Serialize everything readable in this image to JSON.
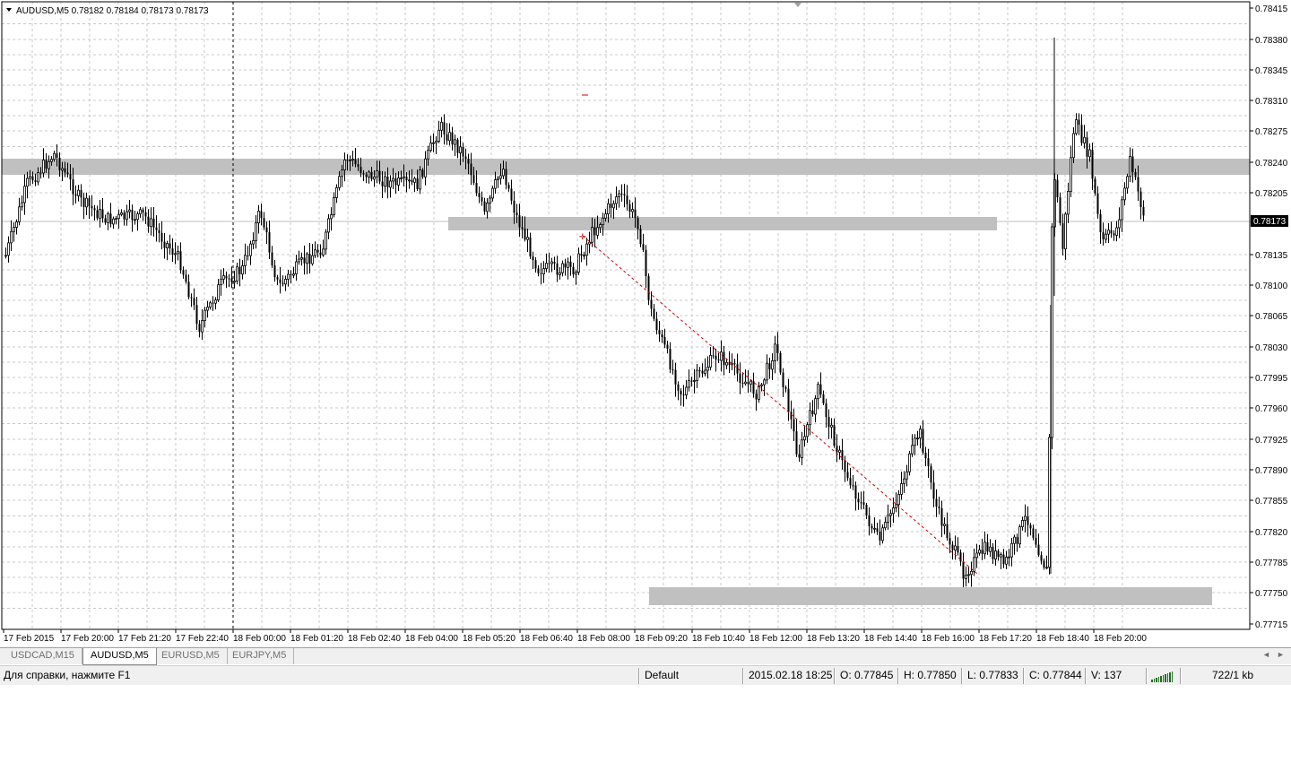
{
  "chart": {
    "header": "AUDUSD,M5  0.78182 0.78184 0.78173 0.78173",
    "current_price_label": "0.78173",
    "price_axis_labels": [
      "0.78415",
      "0.78380",
      "0.78345",
      "0.78310",
      "0.78275",
      "0.78240",
      "0.78205",
      "0.78135",
      "0.78100",
      "0.78065",
      "0.78030",
      "0.77995",
      "0.77960",
      "0.77925",
      "0.77890",
      "0.77855",
      "0.77820",
      "0.77785",
      "0.77750",
      "0.77715"
    ],
    "time_axis_labels": [
      "17 Feb 2015",
      "17 Feb 20:00",
      "17 Feb 21:20",
      "17 Feb 22:40",
      "18 Feb 00:00",
      "18 Feb 01:20",
      "18 Feb 02:40",
      "18 Feb 04:00",
      "18 Feb 05:20",
      "18 Feb 06:40",
      "18 Feb 08:00",
      "18 Feb 09:20",
      "18 Feb 10:40",
      "18 Feb 12:00",
      "18 Feb 13:20",
      "18 Feb 14:40",
      "18 Feb 16:00",
      "18 Feb 17:20",
      "18 Feb 18:40",
      "18 Feb 20:00"
    ],
    "colors": {
      "zone": "#c0c0c0",
      "grid": "#c8c8c8",
      "candle": "#000000",
      "trend_line": "#cc0000",
      "bid_line": "#bfbfbf"
    }
  },
  "tabs": [
    {
      "label": "USDCAD,M15",
      "active": false
    },
    {
      "label": "AUDUSD,M5",
      "active": true
    },
    {
      "label": "EURUSD,M5",
      "active": false
    },
    {
      "label": "EURJPY,M5",
      "active": false
    }
  ],
  "tab_scroll": {
    "left_icon": "arrow-left-icon",
    "right_icon": "arrow-right-icon",
    "left": "◄",
    "right": "►"
  },
  "status_bar": {
    "help": "Для справки, нажмите F1",
    "profile": "Default",
    "datetime": "2015.02.18 18:25",
    "open": "O: 0.77845",
    "high": "H: 0.77850",
    "low": "L: 0.77833",
    "close": "C: 0.77844",
    "volume": "V: 137",
    "traffic": "722/1 kb",
    "connection_icon": "connection-bars-icon"
  }
}
